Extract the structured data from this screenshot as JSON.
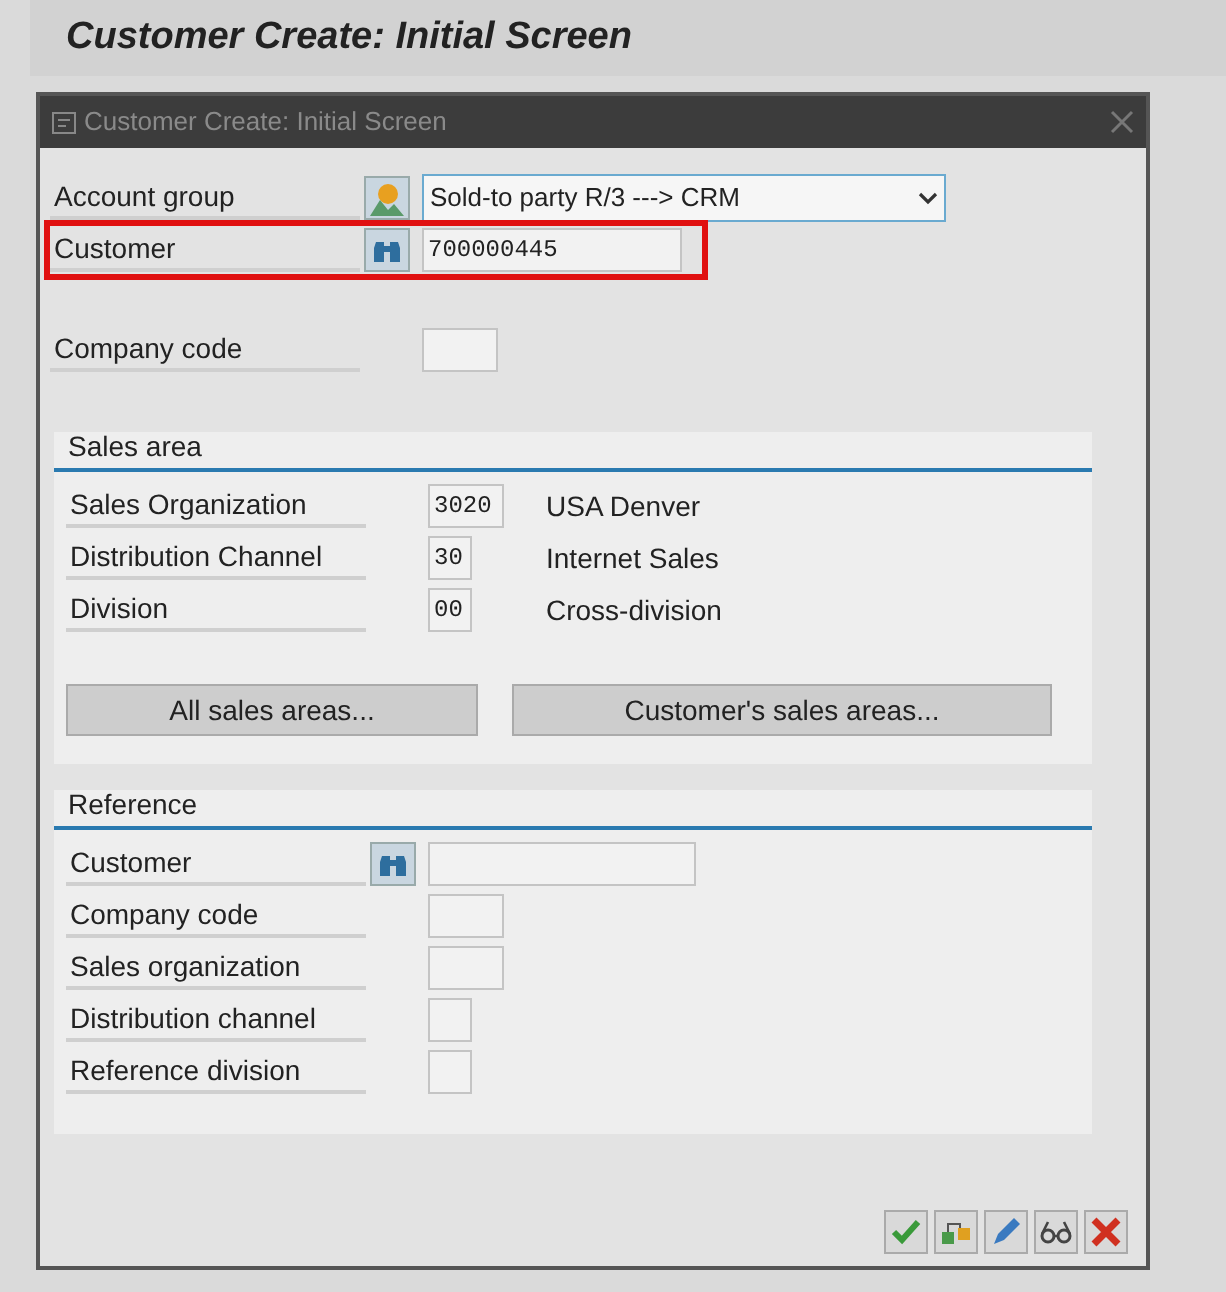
{
  "screen_title": "Customer Create: Initial Screen",
  "dialog": {
    "title": "Customer Create: Initial Screen"
  },
  "fields": [
    {
      "kind": "dropdown",
      "label": "Account group",
      "value": "Sold-to party R/3 ---> CRM",
      "highlighted": false
    },
    {
      "kind": "search",
      "label": "Customer",
      "value": "700000445",
      "highlighted": true
    },
    {
      "kind": "code",
      "label": "Company code",
      "highlighted": false
    }
  ],
  "sales_area": {
    "title": "Sales area",
    "rows": [
      {
        "kind": "code",
        "label": "Sales Organization",
        "value": "3020",
        "description": "USA Denver"
      },
      {
        "kind": "short",
        "label": "Distribution Channel",
        "value": "30",
        "description": "Internet Sales"
      },
      {
        "kind": "short",
        "label": "Division",
        "value": "00",
        "description": "Cross-division"
      }
    ],
    "buttons": [
      "All sales areas...",
      "Customer's sales areas..."
    ]
  },
  "reference": {
    "title": "Reference",
    "rows": [
      {
        "kind": "search",
        "label": "Customer"
      },
      {
        "kind": "code",
        "label": "Company code"
      },
      {
        "kind": "code",
        "label": "Sales organization"
      },
      {
        "kind": "short",
        "label": "Distribution channel"
      },
      {
        "kind": "short",
        "label": "Reference division"
      }
    ]
  }
}
